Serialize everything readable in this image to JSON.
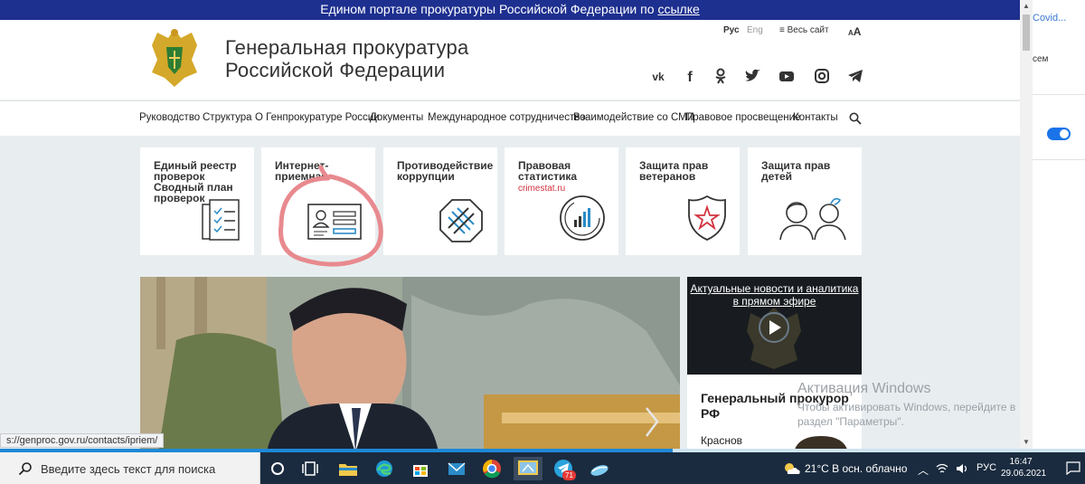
{
  "banner": {
    "text": "Едином портале прокуратуры Российской Федерации по",
    "link": "ссылке"
  },
  "header": {
    "title_line1": "Генеральная прокуратура",
    "title_line2": "Российской Федерации",
    "lang_ru": "Рус",
    "lang_en": "Eng",
    "all_site": "Весь сайт",
    "font_size": "A"
  },
  "social": [
    "vk-icon",
    "facebook-icon",
    "odnoklassniki-icon",
    "twitter-icon",
    "youtube-icon",
    "instagram-icon",
    "telegram-icon"
  ],
  "nav": [
    "Руководство",
    "Структура",
    "О Генпрокуратуре России",
    "Документы",
    "Международное сотрудничество",
    "Взаимодействие со СМИ",
    "Правовое просвещение",
    "Контакты"
  ],
  "tiles": [
    {
      "title": "Единый реестр проверок Сводный план проверок",
      "icon": "documents-checklist-icon"
    },
    {
      "title": "Интернет-приемная",
      "icon": "id-card-icon"
    },
    {
      "title": "Противодействие коррупции",
      "icon": "crossed-money-icon"
    },
    {
      "title": "Правовая статистика",
      "sub": "crimestat.ru",
      "icon": "statistics-gauge-icon"
    },
    {
      "title": "Защита прав ветеранов",
      "icon": "star-shield-icon"
    },
    {
      "title": "Защита прав детей",
      "icon": "children-icon"
    }
  ],
  "live": {
    "caption": "Актуальные новости и аналитика в прямом эфире"
  },
  "gp": {
    "heading": "Генеральный прокурор РФ",
    "name": "Краснов"
  },
  "windows_watermark": {
    "line1": "Активация Windows",
    "line2": "Чтобы активировать Windows, перейдите в раздел \"Параметры\"."
  },
  "status_url": "s://genproc.gov.ru/contacts/ipriem/",
  "sidebar": {
    "text1": "Covid...",
    "text2": "сем"
  },
  "taskbar": {
    "search_placeholder": "Введите здесь текст для поиска",
    "weather": "21°C  В осн. облачно",
    "lang": "РУС",
    "time": "16:47",
    "date": "29.06.2021",
    "telegram_badge": "71"
  },
  "colors": {
    "banner": "#1d2f8f",
    "accent_red": "#d2333f",
    "annotation": "#e88a8f",
    "taskbar": "#1b2b3f"
  },
  "download_progress": 0.62
}
